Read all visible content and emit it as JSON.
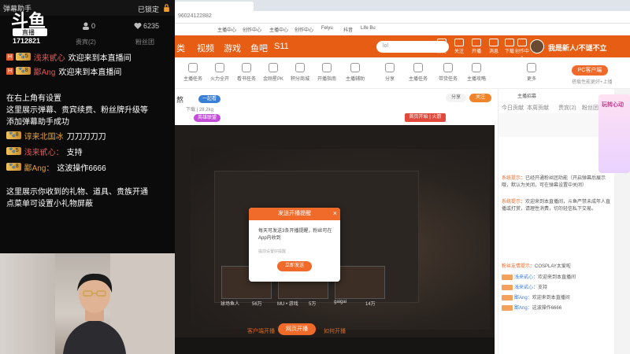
{
  "assistant": {
    "title": "弹幕助手",
    "lock_label": "已锁定",
    "room_id": "1712821",
    "stats": {
      "user_count": "0",
      "likes": "6235"
    },
    "tabs": [
      "贵宾(2)",
      "粉丝团"
    ],
    "logo_lines": [
      "斗鱼",
      "直播"
    ],
    "chat": [
      {
        "badge": "🐾5",
        "name": "浅来甙心",
        "name_style": "red",
        "msg": "欢迎来到本直播间"
      },
      {
        "badge": "🐾8",
        "name": "鄙Ang",
        "name_style": "red",
        "msg": "欢迎来到本直播间"
      }
    ],
    "notes_top": [
      "在右上角有设置",
      "这里展示弹幕、贵宾续费、粉丝牌升级等",
      "添加弹幕助手成功"
    ],
    "chat2": [
      {
        "badge": "🐾8",
        "name": "谆来北国冰",
        "name_style": "normal",
        "msg": "刀刀刀刀刀"
      },
      {
        "badge": "🐾5",
        "name": "浅来甙心：",
        "name_style": "red",
        "msg": "支持"
      },
      {
        "badge": "🐾8",
        "name": "鄙Ang：",
        "name_style": "normal",
        "msg": "这波操作6666"
      }
    ],
    "notes_bottom": [
      "这里展示你收到的礼物、道具、贵族开通",
      "点菜单可设置小礼物屏蔽"
    ]
  },
  "browser": {
    "tab_title": "",
    "url": "96024122882",
    "bookmarks": [
      "主播中心",
      "创作中心",
      "主播中心",
      "创作中心",
      "Feiyu",
      "抖音",
      "Life Bu"
    ],
    "nav": [
      "类",
      "视频",
      "游戏",
      "鱼吧",
      "S11"
    ],
    "search_placeholder": "lol",
    "header_icons": [
      "历史",
      "关注",
      "开播",
      "消息",
      "下载",
      "创作中心"
    ],
    "user_name": "我是新人/不谜不立",
    "categories": [
      "主播任务",
      "火力全开",
      "看书任务",
      "金刚星PK",
      "积分商城",
      "开播指南",
      "主播辅助",
      "分享",
      "主播任务",
      "带货任务",
      "主播攻略",
      "更多"
    ],
    "pc_button": "PC客户端",
    "pc_sub": "搭载性能更好+上播",
    "room": {
      "title": "熬",
      "tags": [
        "一起看",
        "英雄联盟"
      ],
      "meta": "下载  |  28.2kg",
      "rank_chip": "首页开始 | 火箭",
      "follow": "关注",
      "share": "分享"
    },
    "player": {
      "thumbs": [
        "球场鱼人",
        "MU • 游戏",
        "gaigai"
      ],
      "thumb_counts": [
        "56万",
        "5万",
        "14万"
      ],
      "left_link": "客户端开播",
      "main_button": "网页开播",
      "right_link": "如何开播"
    },
    "modal": {
      "title": "发送开播提醒",
      "body": "每天可发送3条开播提醒，粉丝可在App内收到",
      "sub": "提前设置好提醒",
      "button": "立即发送"
    },
    "right": {
      "head": "主播招募",
      "tabs": [
        "今日贡献",
        "本周贡献",
        "贵宾(2)",
        "粉丝团"
      ],
      "messages": [
        {
          "sys": "系统提示：",
          "text": "已经开通粉丝团功能（开启弹幕后展示哦，默认为关闭，可在弹幕设置中关闭）"
        },
        {
          "sys": "系统提示：",
          "text": "欢迎来到本直播间，斗鱼严禁未成年人直播或打赏，请理性消费，切勿轻信私下交易。"
        },
        {
          "sys": "粉丝友情提示：",
          "text": "COSPLAY太爱啦"
        },
        {
          "nm": "浅来甙心：",
          "text": "欢迎来到本直播间"
        },
        {
          "nm": "浅来甙心：",
          "text": "支持"
        },
        {
          "nm": "鄙Ang：",
          "text": "欢迎来到本直播间"
        },
        {
          "nm": "鄙Ang：",
          "text": "这波操作6666"
        }
      ],
      "promo": "玩转心动"
    }
  },
  "colors": {
    "brand": "#f06a2a",
    "header": "#e85d14",
    "chat_name": "#e7a03a",
    "chat_name_red": "#e55353"
  }
}
